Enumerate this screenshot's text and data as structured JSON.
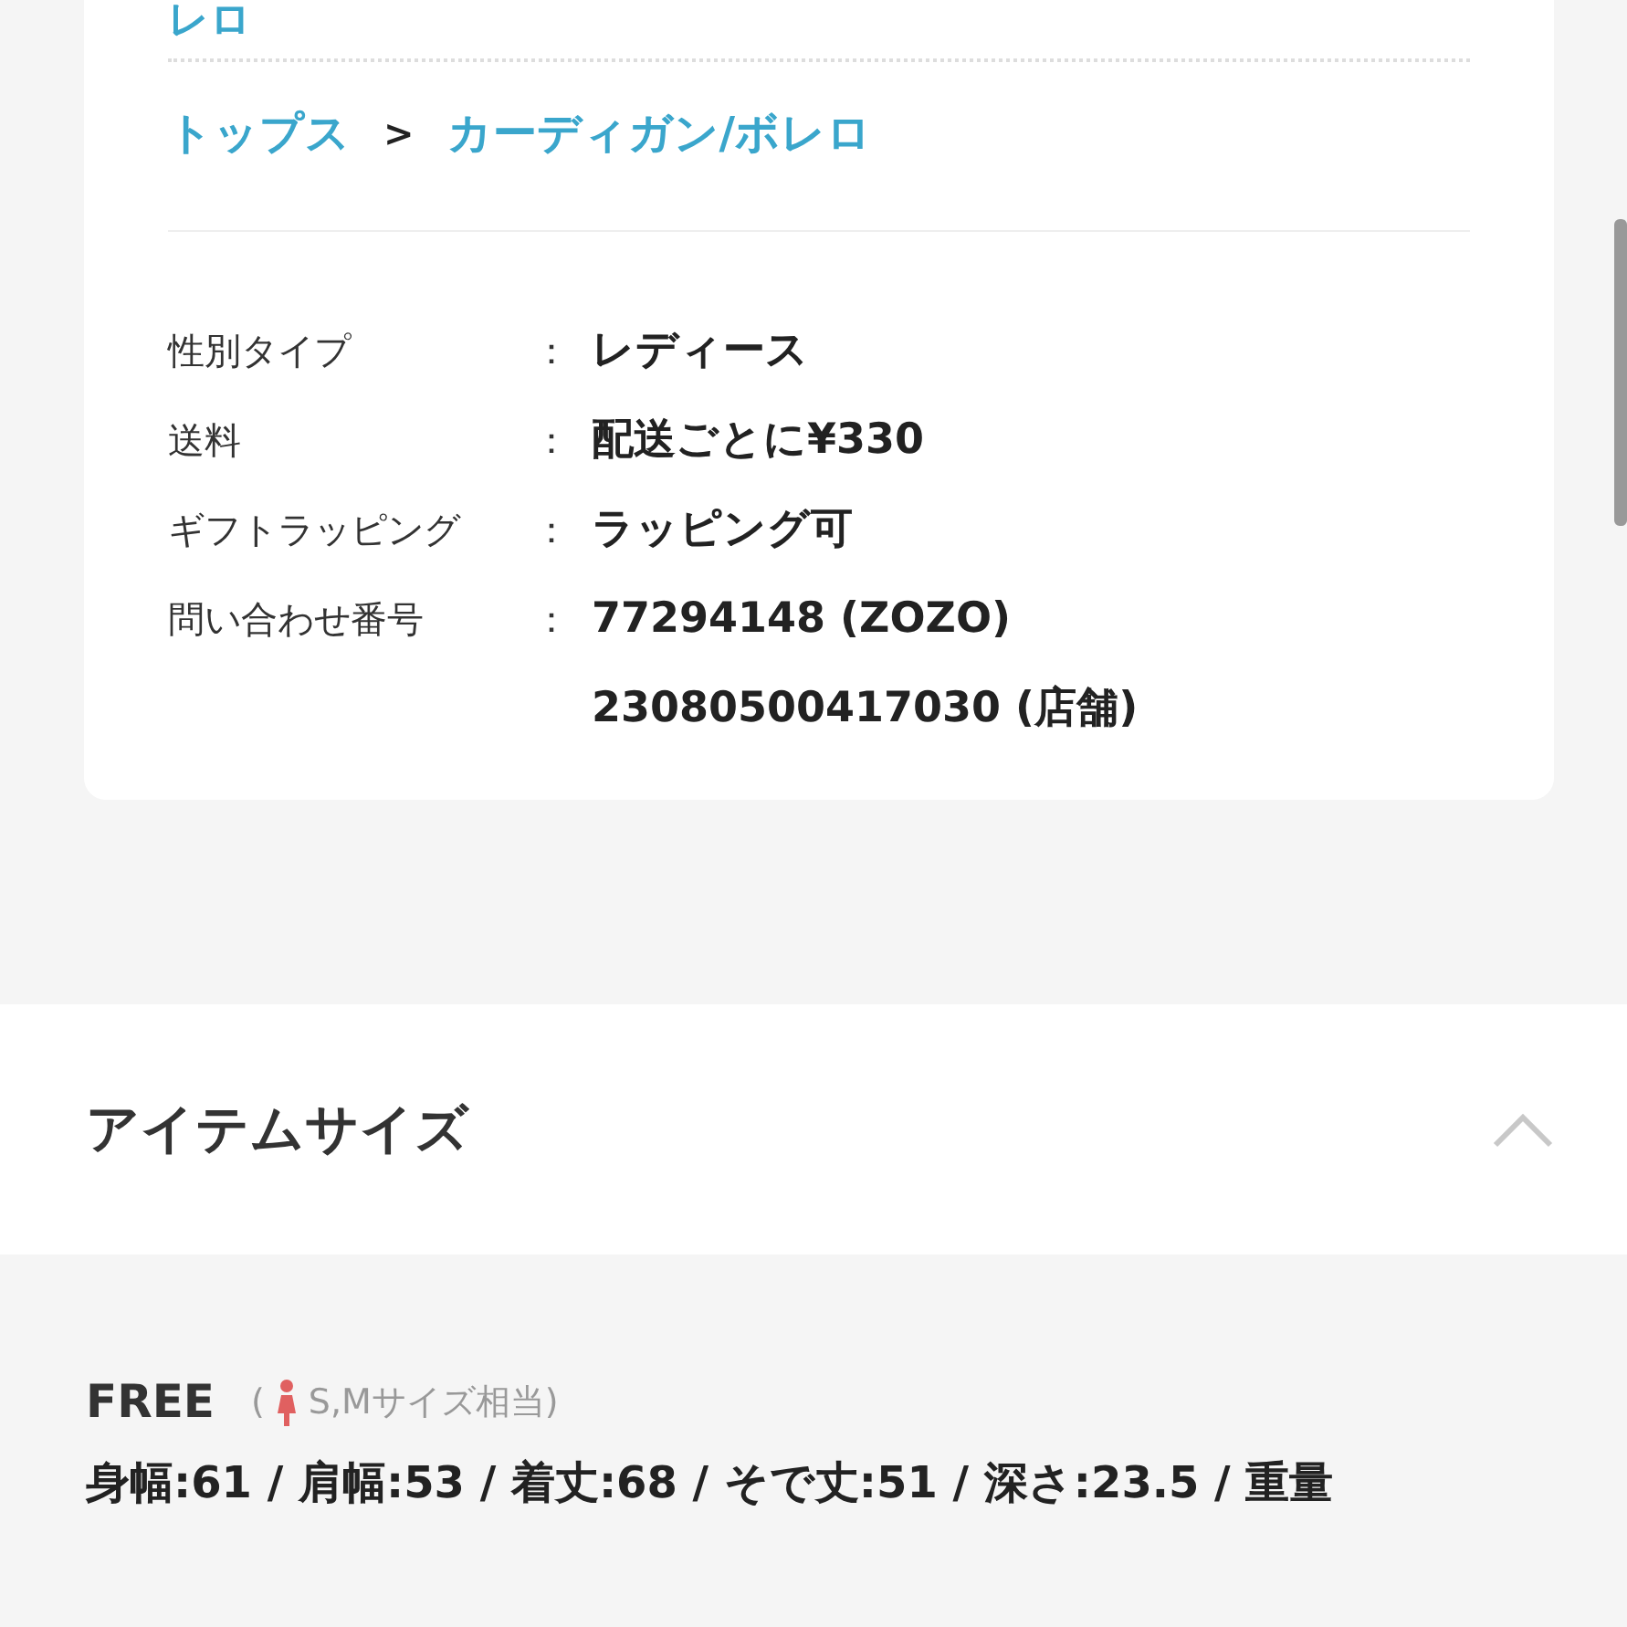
{
  "card": {
    "top_text": "レロ",
    "breadcrumb": {
      "items": [
        "トップス",
        "カーディガン/ボレロ"
      ],
      "separator": ">"
    },
    "specs": [
      {
        "label": "性別タイプ",
        "colon": "：",
        "values": [
          "レディース"
        ]
      },
      {
        "label": "送料",
        "colon": "：",
        "values": [
          "配送ごとに¥330"
        ]
      },
      {
        "label": "ギフトラッピング",
        "colon": "：",
        "values": [
          "ラッピング可"
        ]
      },
      {
        "label": "問い合わせ番号",
        "colon": "：",
        "values": [
          "77294148 (ZOZO)",
          "23080500417030 (店舗)"
        ]
      }
    ]
  },
  "item_size": {
    "title": "アイテムサイズ",
    "expanded": true,
    "size": {
      "label": "FREE",
      "note_open": "(",
      "note": "S,Mサイズ相当)",
      "measurements": "身幅:61 / 肩幅:53 / 着丈:68 / そで丈:51 / 深さ:23.5 / 重量"
    }
  }
}
